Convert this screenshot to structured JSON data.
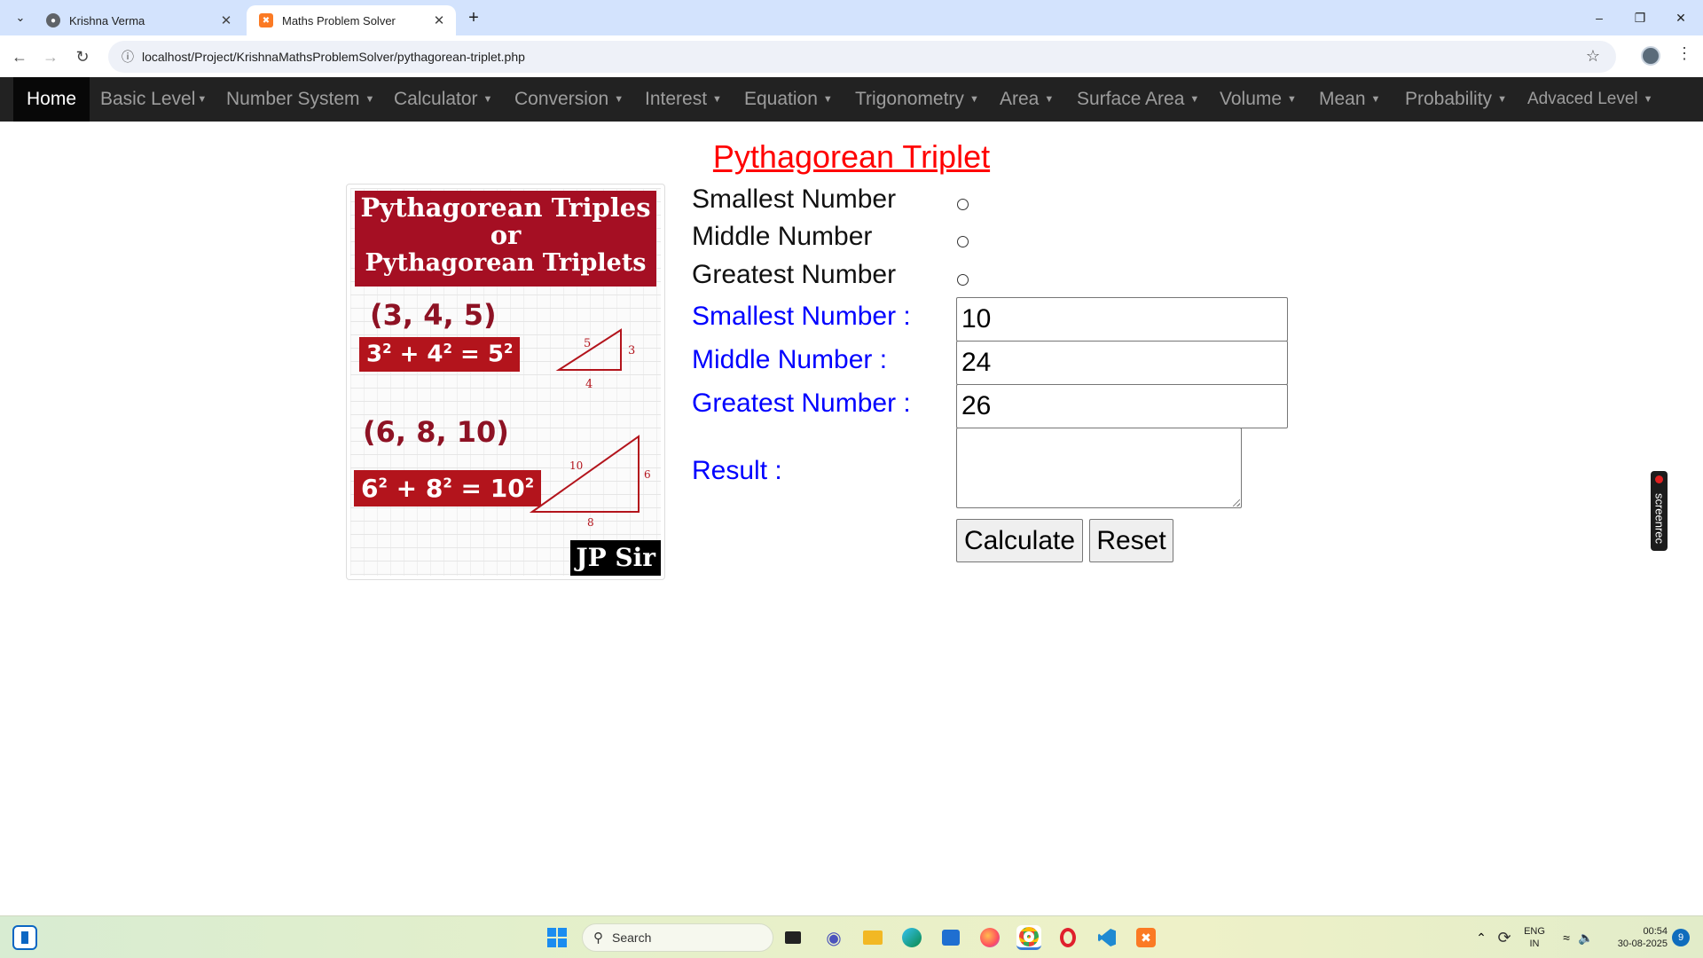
{
  "browser": {
    "tabs": [
      {
        "title": "Krishna Verma",
        "active": false,
        "icon": "globe-icon"
      },
      {
        "title": "Maths Problem Solver",
        "active": true,
        "icon": "xampp-icon"
      }
    ],
    "url": "localhost/Project/KrishnaMathsProblemSolver/pythagorean-triplet.php"
  },
  "navbar": {
    "home": "Home",
    "items": [
      {
        "label": "Basic Level"
      },
      {
        "label": "Number System"
      },
      {
        "label": "Calculator"
      },
      {
        "label": "Conversion"
      },
      {
        "label": "Interest"
      },
      {
        "label": "Equation"
      },
      {
        "label": "Trigonometry"
      },
      {
        "label": "Area"
      },
      {
        "label": "Surface Area"
      },
      {
        "label": "Volume"
      },
      {
        "label": "Mean"
      },
      {
        "label": "Probability"
      },
      {
        "label": "Advaced Level"
      }
    ]
  },
  "page": {
    "title": "Pythagorean Triplet",
    "illustration": {
      "banner_line1": "Pythagorean Triples",
      "banner_line2": "or",
      "banner_line3": "Pythagorean Triplets",
      "triple1": "(3, 4, 5)",
      "eq1": {
        "a": "3",
        "b": "4",
        "c": "5",
        "exp": "2"
      },
      "tri1": {
        "hyp": "5",
        "side": "3",
        "base": "4"
      },
      "triple2": "(6, 8, 10)",
      "eq2": {
        "a": "6",
        "b": "8",
        "c": "10",
        "exp": "2"
      },
      "tri2": {
        "hyp": "10",
        "side": "6",
        "base": "8"
      },
      "signature": "JP Sir"
    },
    "options": {
      "smallest": "Smallest Number",
      "middle": "Middle Number",
      "greatest": "Greatest Number"
    },
    "inputs": {
      "smallest_label": "Smallest Number :",
      "smallest_value": "10",
      "middle_label": "Middle Number :",
      "middle_value": "24",
      "greatest_label": "Greatest Number :",
      "greatest_value": "26",
      "result_label": "Result :",
      "result_value": ""
    },
    "buttons": {
      "calculate": "Calculate",
      "reset": "Reset"
    }
  },
  "screenrec": {
    "label": "screenrec"
  },
  "taskbar": {
    "search_placeholder": "Search",
    "language": "ENG",
    "region": "IN",
    "time": "00:54",
    "date": "30-08-2025",
    "notifications": "9"
  }
}
